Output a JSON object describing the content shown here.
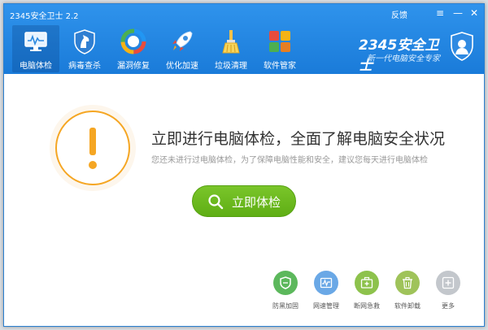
{
  "window": {
    "title": "2345安全卫士 2.2",
    "feedback_label": "反馈",
    "menu_glyph": "≡",
    "minimize_glyph": "—",
    "close_glyph": "✕"
  },
  "nav": {
    "items": [
      {
        "label": "电脑体检",
        "icon": "monitor-icon",
        "active": true
      },
      {
        "label": "病毒查杀",
        "icon": "horse-shield-icon",
        "active": false
      },
      {
        "label": "漏洞修复",
        "icon": "repair-ring-icon",
        "active": false
      },
      {
        "label": "优化加速",
        "icon": "rocket-icon",
        "active": false
      },
      {
        "label": "垃圾清理",
        "icon": "broom-icon",
        "active": false
      },
      {
        "label": "软件管家",
        "icon": "app-grid-icon",
        "active": false
      }
    ]
  },
  "brand": {
    "logo_text": "2345安全卫士",
    "slogan": "新一代电脑安全专家"
  },
  "main": {
    "headline": "立即进行电脑体检，全面了解电脑安全状况",
    "subline": "您还未进行过电脑体检，为了保障电脑性能和安全，建议您每天进行电脑体检",
    "check_button_label": "立即体检"
  },
  "tools": [
    {
      "label": "防黑加固",
      "icon": "shield-icon",
      "color": "#5cb85c"
    },
    {
      "label": "网速管理",
      "icon": "speed-chart-icon",
      "color": "#6aa8e6"
    },
    {
      "label": "断网急救",
      "icon": "first-aid-icon",
      "color": "#8dc24c"
    },
    {
      "label": "软件卸载",
      "icon": "trash-icon",
      "color": "#9fc35a"
    },
    {
      "label": "更多",
      "icon": "plus-icon",
      "color": "#c3c7cc"
    }
  ],
  "colors": {
    "header": "#1f82dd",
    "accent_orange": "#f5a623",
    "button_green": "#6cb81f"
  }
}
